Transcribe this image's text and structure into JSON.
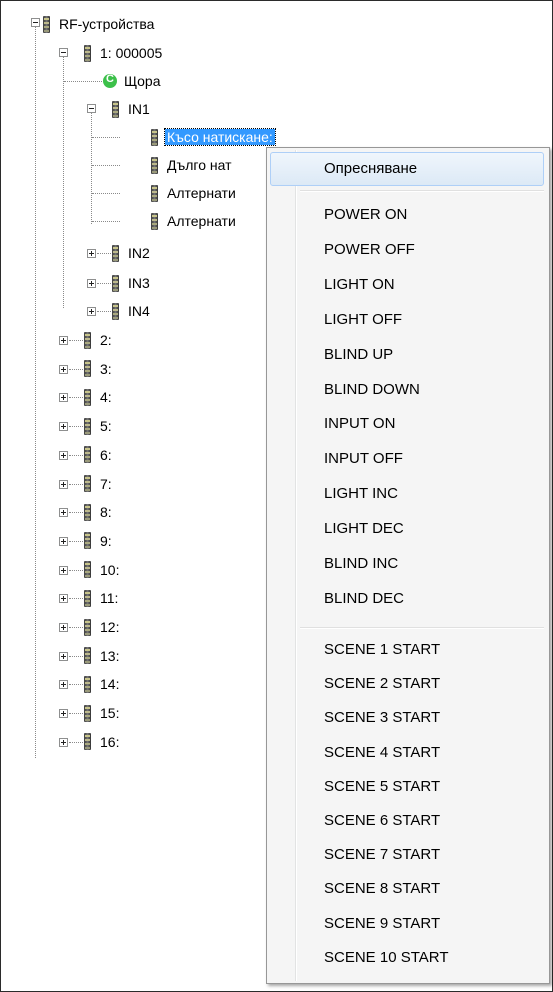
{
  "tree": {
    "root": {
      "label": "RF-устройства"
    },
    "device1": {
      "label": "1: 000005"
    },
    "state": {
      "label": "Щора"
    },
    "in1": {
      "label": "IN1",
      "children": [
        "Късо натискане:",
        "Дълго нат",
        "Алтернати",
        "Алтернати"
      ]
    },
    "inputs": [
      "IN2",
      "IN3",
      "IN4"
    ],
    "devices": [
      "2:",
      "3:",
      "4:",
      "5:",
      "6:",
      "7:",
      "8:",
      "9:",
      "10:",
      "11:",
      "12:",
      "13:",
      "14:",
      "15:",
      "16:"
    ]
  },
  "context_menu": {
    "refresh": "Опресняване",
    "group1": [
      "POWER ON",
      "POWER OFF",
      "LIGHT ON",
      "LIGHT OFF",
      "BLIND UP",
      "BLIND DOWN",
      "INPUT ON",
      "INPUT OFF",
      "LIGHT INC",
      "LIGHT DEC",
      "BLIND INC",
      "BLIND DEC"
    ],
    "group2": [
      "SCENE 1 START",
      "SCENE 2 START",
      "SCENE 3 START",
      "SCENE 4 START",
      "SCENE 5 START",
      "SCENE 6 START",
      "SCENE 7 START",
      "SCENE 8 START",
      "SCENE 9 START",
      "SCENE 10 START"
    ]
  },
  "colors": {
    "selection": "#3399ff",
    "state_icon": "#3cc04a",
    "menu_bg": "#f5f5f5"
  },
  "icons": {
    "device": "device-icon",
    "state": "status-icon",
    "expand": "expander-icon"
  }
}
